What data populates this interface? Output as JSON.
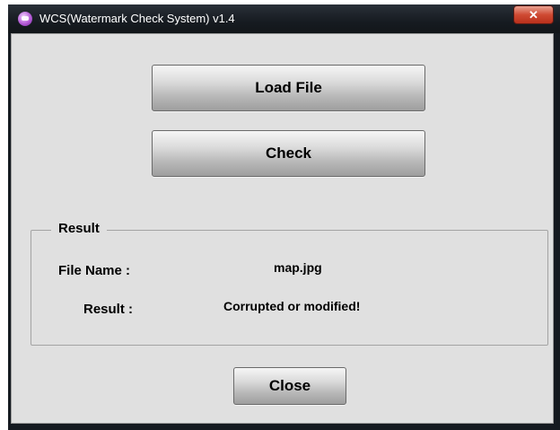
{
  "window": {
    "title": "WCS(Watermark Check System) v1.4",
    "close_glyph": "✕"
  },
  "buttons": {
    "load_file": "Load File",
    "check": "Check",
    "close": "Close"
  },
  "result": {
    "group_label": "Result",
    "file_name_label": "File Name :",
    "file_name_value": "map.jpg",
    "result_label": "Result :",
    "result_value": "Corrupted or modified!"
  },
  "colors": {
    "client_bg": "#e0e0e0",
    "titlebar": "#161b21",
    "close_button": "#cf4a32"
  },
  "icons": {
    "app": "app-icon",
    "close": "close-icon"
  }
}
